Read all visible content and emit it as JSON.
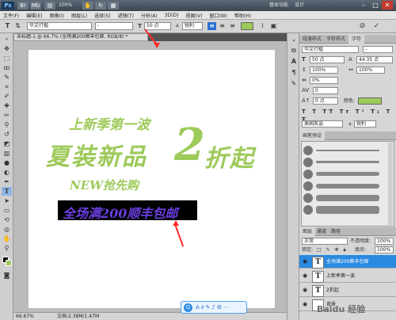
{
  "titlebar": {
    "logo": "Ps",
    "zoom": "100%",
    "modes": [
      "基本功能",
      "设计"
    ],
    "window_buttons": [
      "–",
      "□",
      "✕"
    ]
  },
  "menu": [
    "文件(F)",
    "编辑(E)",
    "图像(I)",
    "图层(L)",
    "选择(S)",
    "滤镜(T)",
    "分析(A)",
    "3D(D)",
    "视图(V)",
    "窗口(W)",
    "帮助(H)"
  ],
  "options": {
    "font_family": "华文行楷",
    "font_style": "-",
    "font_size": "50 点",
    "anti_alias_prefix": "a",
    "anti_alias": "锐利",
    "text_color": "#9dca5a"
  },
  "document": {
    "tab_title": "未标题-1 @ 66.7% (全场满200顺丰包邮, RGB/8) *",
    "line1": "上新季第一波",
    "line2_part1": "夏装新品",
    "line2_big": "2",
    "line2_part2": "折起",
    "line3": "NEW抢先购",
    "line4": "全场满200顺丰包邮",
    "line4_color": "#6a3fe0",
    "status_zoom": "66.67%",
    "status_doc": "文档:2.38M/1.47M"
  },
  "panels": {
    "char_tabs": [
      "段落样式",
      "字符样式",
      "字符"
    ],
    "char_font": "华文行楷",
    "char_style": "-",
    "char_size": "50 点",
    "char_leading": "44.35 点",
    "scale_v": "100%",
    "scale_h": "100%",
    "tracking": "0%",
    "kerning": "0",
    "baseline": "0 点",
    "color_label": "颜色:",
    "language": "美国英语",
    "aa_prefix": "a",
    "aa_value": "锐利",
    "brush_tabs": [
      "画笔预设"
    ],
    "layer_tabs": [
      "图层",
      "通道",
      "路径"
    ],
    "blend_mode": "正常",
    "opacity_label": "不透明度:",
    "opacity_value": "100%",
    "lock_label": "锁定:",
    "fill_label": "填充:",
    "fill_value": "100%",
    "layers": [
      {
        "name": "全场满200顺丰包邮",
        "thumb": "T",
        "selected": true
      },
      {
        "name": "上新季第一波",
        "thumb": "T",
        "selected": false
      },
      {
        "name": "2折起",
        "thumb": "T",
        "selected": false
      },
      {
        "name": "背景",
        "thumb": "",
        "selected": false
      }
    ]
  },
  "watermark": "Baidu 经验",
  "floatbar_icons": [
    "search-icon",
    "text-icon",
    "link-icon",
    "edit-icon",
    "tool-icon",
    "settings-icon",
    "more-icon"
  ]
}
